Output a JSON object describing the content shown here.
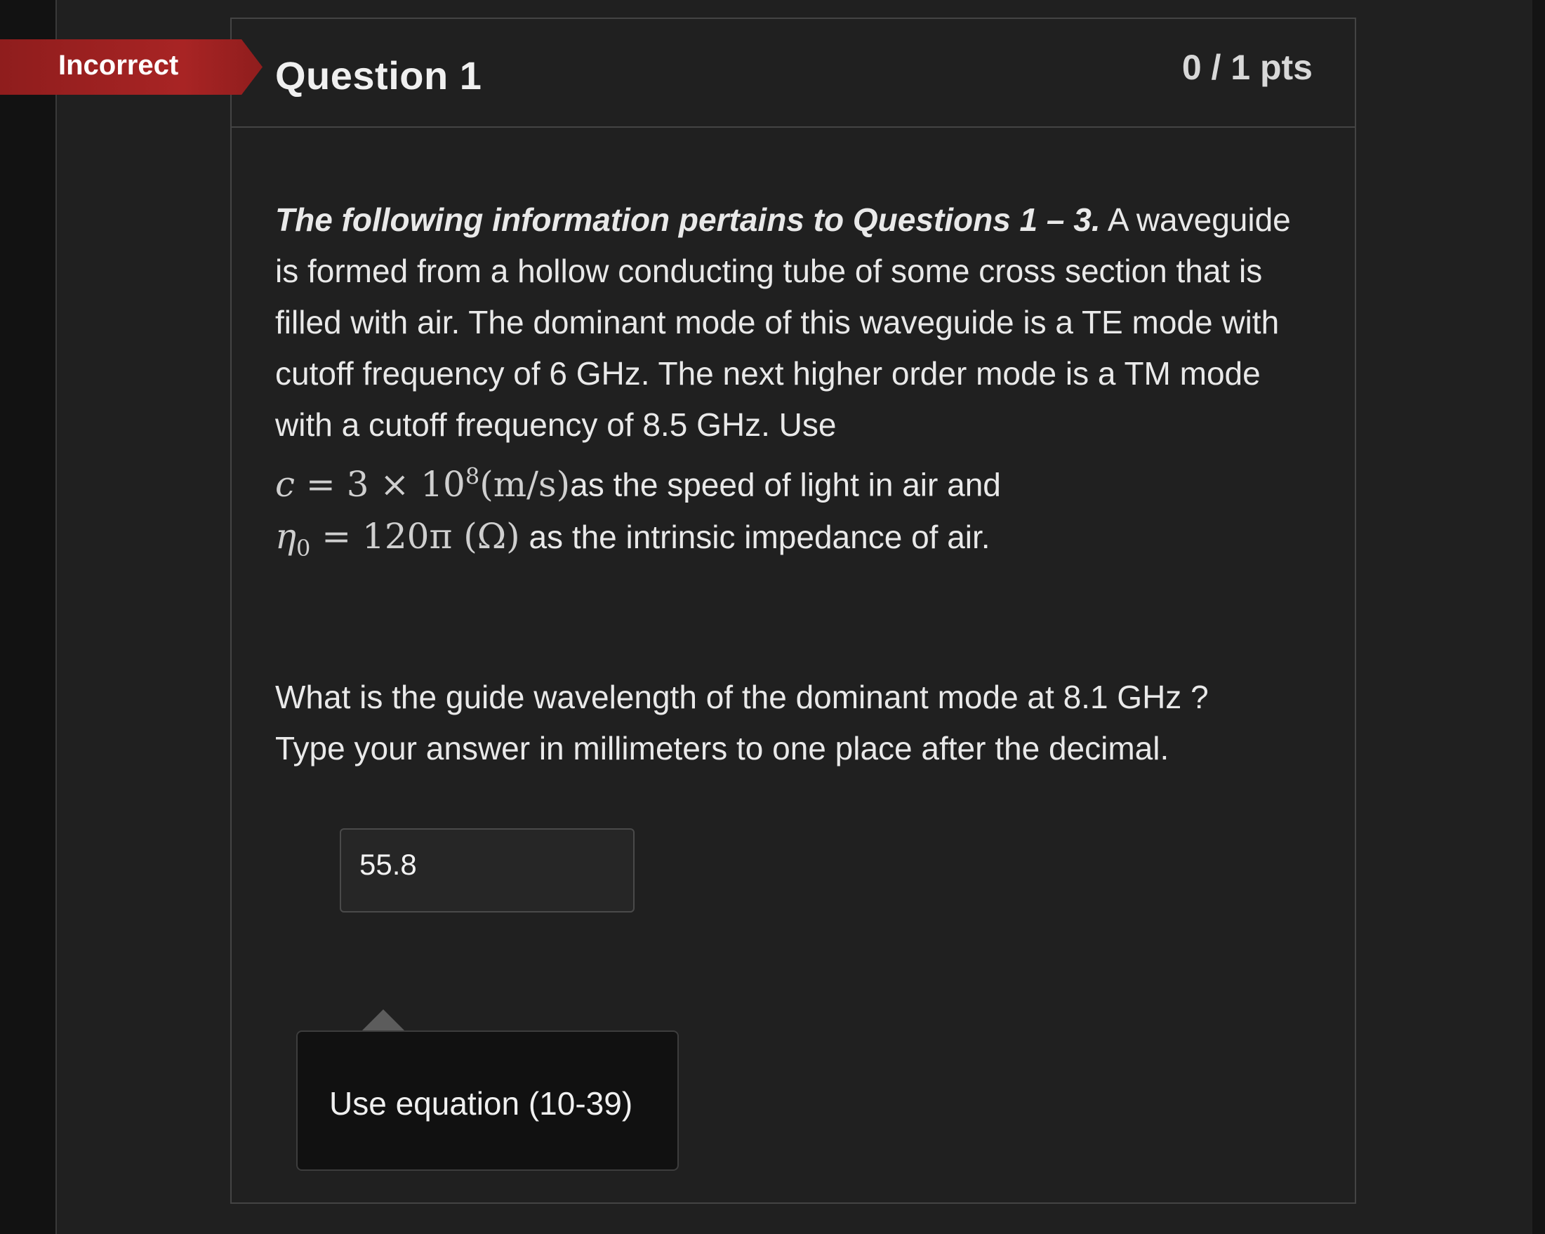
{
  "status": {
    "label": "Incorrect",
    "color": "#a82424"
  },
  "question": {
    "title": "Question 1",
    "points": "0 / 1 pts",
    "intro_bold": "The following information pertains to Questions 1 – 3.",
    "intro_text_1": " A waveguide is formed from a hollow conducting tube of some cross section that is filled with air.  The dominant mode of this waveguide is a TE mode with cutoff frequency of 6 GHz.  The next higher order mode is a TM mode with a cutoff frequency of 8.5 GHz.  Use",
    "math_c_lhs": "c",
    "math_c_rhs": " = 3 × 10",
    "math_c_exp": "8",
    "math_c_unit": "(m/s)",
    "intro_text_2": "as the speed of light in air and",
    "math_eta_lhs": "η",
    "math_eta_sub": "0",
    "math_eta_rhs": " = 120π  (Ω)",
    "intro_text_3": " as the intrinsic impedance of air.",
    "prompt_line_1": "What is the guide wavelength of the dominant mode at 8.1 GHz ?",
    "prompt_line_2": "Type your answer in millimeters to one place after the decimal."
  },
  "answer": {
    "value": "55.8"
  },
  "feedback": {
    "text": "Use equation (10-39)"
  },
  "icons": {
    "feedback_pointer": "caret-up-icon"
  }
}
